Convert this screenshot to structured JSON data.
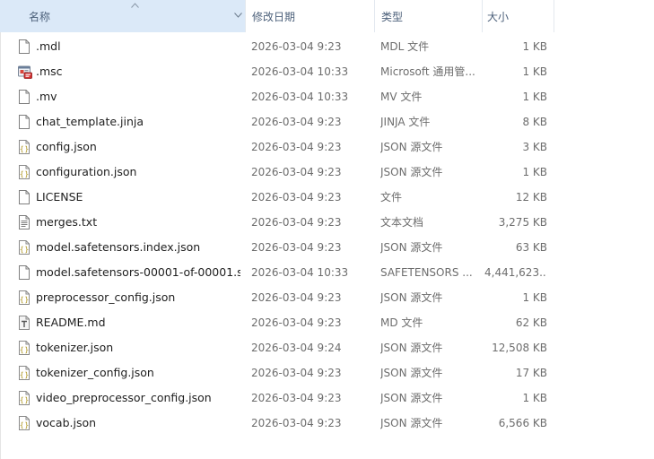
{
  "columns": {
    "name": "名称",
    "date": "修改日期",
    "type": "类型",
    "size": "大小"
  },
  "files": [
    {
      "icon": "blank-file-icon",
      "name": ".mdl",
      "date": "2026-03-04 9:23",
      "type": "MDL 文件",
      "size": "1 KB"
    },
    {
      "icon": "msc-installer-icon",
      "name": ".msc",
      "date": "2026-03-04 10:33",
      "type": "Microsoft 通用管...",
      "size": "1 KB"
    },
    {
      "icon": "blank-file-icon",
      "name": ".mv",
      "date": "2026-03-04 10:33",
      "type": "MV 文件",
      "size": "1 KB"
    },
    {
      "icon": "blank-file-icon",
      "name": "chat_template.jinja",
      "date": "2026-03-04 9:23",
      "type": "JINJA 文件",
      "size": "8 KB"
    },
    {
      "icon": "json-file-icon",
      "name": "config.json",
      "date": "2026-03-04 9:23",
      "type": "JSON 源文件",
      "size": "3 KB"
    },
    {
      "icon": "json-file-icon",
      "name": "configuration.json",
      "date": "2026-03-04 9:23",
      "type": "JSON 源文件",
      "size": "1 KB"
    },
    {
      "icon": "blank-file-icon",
      "name": "LICENSE",
      "date": "2026-03-04 9:23",
      "type": "文件",
      "size": "12 KB"
    },
    {
      "icon": "text-file-icon",
      "name": "merges.txt",
      "date": "2026-03-04 9:23",
      "type": "文本文档",
      "size": "3,275 KB"
    },
    {
      "icon": "json-file-icon",
      "name": "model.safetensors.index.json",
      "date": "2026-03-04 9:23",
      "type": "JSON 源文件",
      "size": "63 KB"
    },
    {
      "icon": "blank-file-icon",
      "name": "model.safetensors-00001-of-00001.s...",
      "date": "2026-03-04 10:33",
      "type": "SAFETENSORS ...",
      "size": "4,441,623..."
    },
    {
      "icon": "json-file-icon",
      "name": "preprocessor_config.json",
      "date": "2026-03-04 9:23",
      "type": "JSON 源文件",
      "size": "1 KB"
    },
    {
      "icon": "markdown-file-icon",
      "name": "README.md",
      "date": "2026-03-04 9:23",
      "type": "MD 文件",
      "size": "62 KB"
    },
    {
      "icon": "json-file-icon",
      "name": "tokenizer.json",
      "date": "2026-03-04 9:24",
      "type": "JSON 源文件",
      "size": "12,508 KB"
    },
    {
      "icon": "json-file-icon",
      "name": "tokenizer_config.json",
      "date": "2026-03-04 9:23",
      "type": "JSON 源文件",
      "size": "17 KB"
    },
    {
      "icon": "json-file-icon",
      "name": "video_preprocessor_config.json",
      "date": "2026-03-04 9:23",
      "type": "JSON 源文件",
      "size": "1 KB"
    },
    {
      "icon": "json-file-icon",
      "name": "vocab.json",
      "date": "2026-03-04 9:23",
      "type": "JSON 源文件",
      "size": "6,566 KB"
    }
  ],
  "colors": {
    "header_selected_bg": "#dbe9f8",
    "header_text": "#4c607a",
    "row_text": "#1e1e1e",
    "meta_text": "#6d6d6d"
  }
}
